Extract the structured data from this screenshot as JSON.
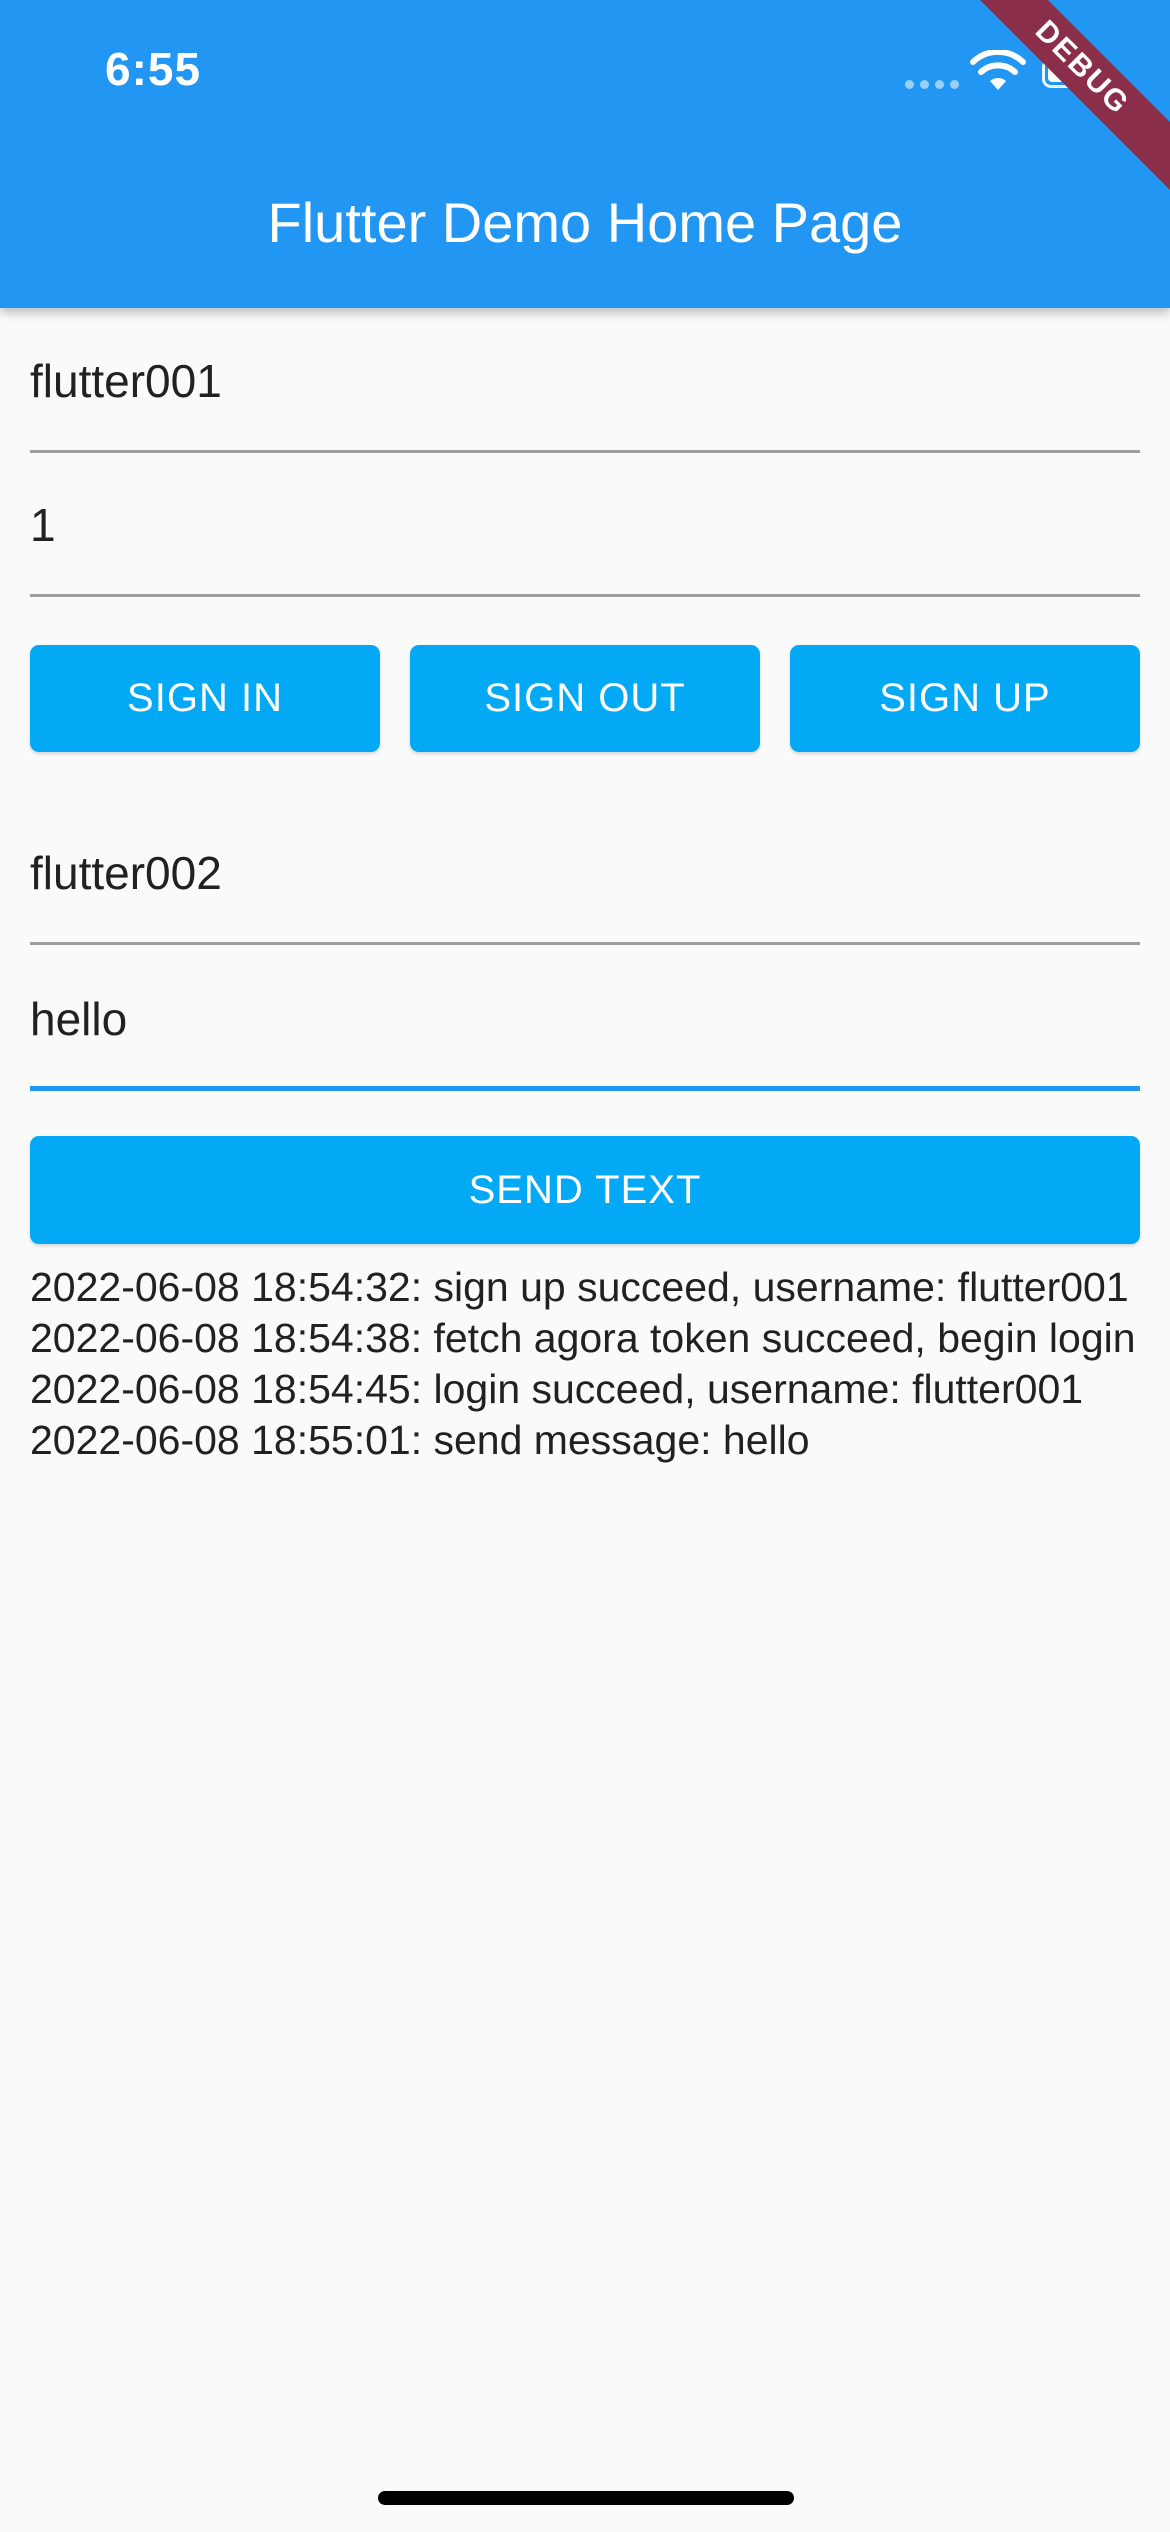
{
  "status_bar": {
    "time": "6:55",
    "debug_label": "DEBUG"
  },
  "app_bar": {
    "title": "Flutter Demo Home Page",
    "color": "#2196f3"
  },
  "login_form": {
    "username_value": "flutter001",
    "password_value": "1",
    "sign_in_label": "SIGN IN",
    "sign_out_label": "SIGN OUT",
    "sign_up_label": "SIGN UP"
  },
  "message_form": {
    "recipient_value": "flutter002",
    "message_value": "hello",
    "send_label": "SEND TEXT"
  },
  "button_color": "#03a9f4",
  "log": [
    "2022-06-08 18:54:32: sign up succeed, username: flutter001",
    "2022-06-08 18:54:38: fetch agora token succeed, begin login",
    "2022-06-08 18:54:45: login succeed, username: flutter001",
    "2022-06-08 18:55:01: send message: hello"
  ]
}
